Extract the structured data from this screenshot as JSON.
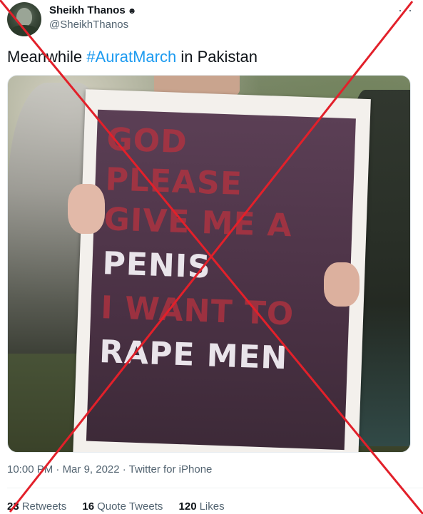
{
  "author": {
    "display_name": "Sheikh Thanos",
    "verified_glyph": "☻",
    "handle": "@SheikhThanos"
  },
  "more_icon": "more-horizontal-icon",
  "more_glyph": "···",
  "tweet": {
    "text_prefix": "Meanwhile ",
    "hashtag": "#AuratMarch",
    "text_suffix": " in Pakistan"
  },
  "poster": {
    "lines": [
      "GOD",
      "PLEASE",
      "GIVE ME A",
      "PENIS",
      "I WANT TO",
      "RAPE MEN"
    ]
  },
  "meta": {
    "time": "10:00 PM",
    "separator": " · ",
    "date": "Mar 9, 2022",
    "source": "Twitter for iPhone"
  },
  "stats": {
    "retweets_count": "23",
    "retweets_label": "Retweets",
    "quote_count": "16",
    "quote_label": "Quote Tweets",
    "likes_count": "120",
    "likes_label": "Likes"
  },
  "colors": {
    "accent": "#1d9bf0",
    "secondary_text": "#536471",
    "overlay_x": "#e2202a"
  }
}
